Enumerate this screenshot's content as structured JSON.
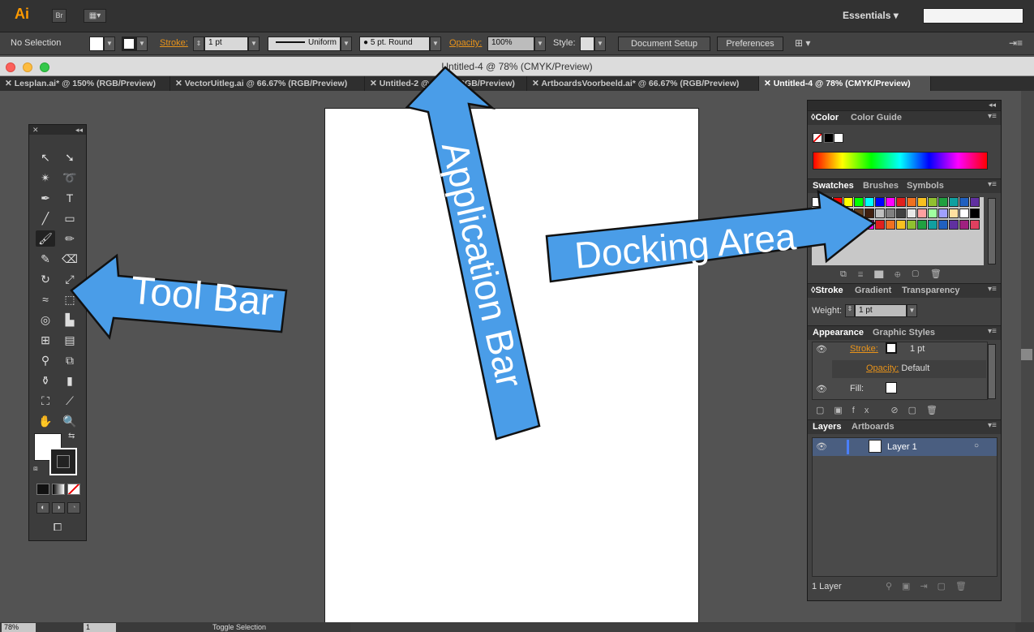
{
  "app": {
    "logo": "Ai",
    "bridge": "Br",
    "workspace": "Essentials ▾"
  },
  "control": {
    "selection": "No Selection",
    "stroke_label": "Stroke:",
    "stroke_value": "1 pt",
    "profile": "Uniform",
    "brush": "5 pt. Round",
    "opacity_label": "Opacity:",
    "opacity_value": "100%",
    "style_label": "Style:",
    "doc_setup": "Document Setup",
    "preferences": "Preferences"
  },
  "window": {
    "title": "Untitled-4 @ 78% (CMYK/Preview)"
  },
  "tabs": [
    {
      "label": "Lesplan.ai* @ 150% (RGB/Preview)"
    },
    {
      "label": "VectorUitleg.ai @ 66.67% (RGB/Preview)"
    },
    {
      "label": "Untitled-2 @ 100% (RGB/Preview)"
    },
    {
      "label": "ArtboardsVoorbeeld.ai* @ 66.67% (RGB/Preview)"
    },
    {
      "label": "Untitled-4 @ 78% (CMYK/Preview)"
    }
  ],
  "dock": {
    "color_tab": "Color",
    "color_guide_tab": "Color Guide",
    "swatches_tab": "Swatches",
    "brushes_tab": "Brushes",
    "symbols_tab": "Symbols",
    "stroke_tab": "Stroke",
    "gradient_tab": "Gradient",
    "transparency_tab": "Transparency",
    "weight_label": "Weight:",
    "weight_value": "1 pt",
    "appearance_tab": "Appearance",
    "graphic_styles_tab": "Graphic Styles",
    "ap_stroke": "Stroke:",
    "ap_stroke_value": "1 pt",
    "ap_opacity": "Opacity:",
    "ap_opacity_value": "Default",
    "ap_fill": "Fill:",
    "layers_tab": "Layers",
    "artboards_tab": "Artboards",
    "layer_name": "Layer 1",
    "layer_count": "1 Layer"
  },
  "status": {
    "zoom": "78%",
    "page": "1",
    "toggle": "Toggle Selection"
  },
  "annotations": {
    "toolbar": "Tool Bar",
    "appbar": "Application Bar",
    "dock": "Docking Area"
  },
  "colors": {
    "arrow": "#4a9de8",
    "accent": "#ff9a00"
  }
}
